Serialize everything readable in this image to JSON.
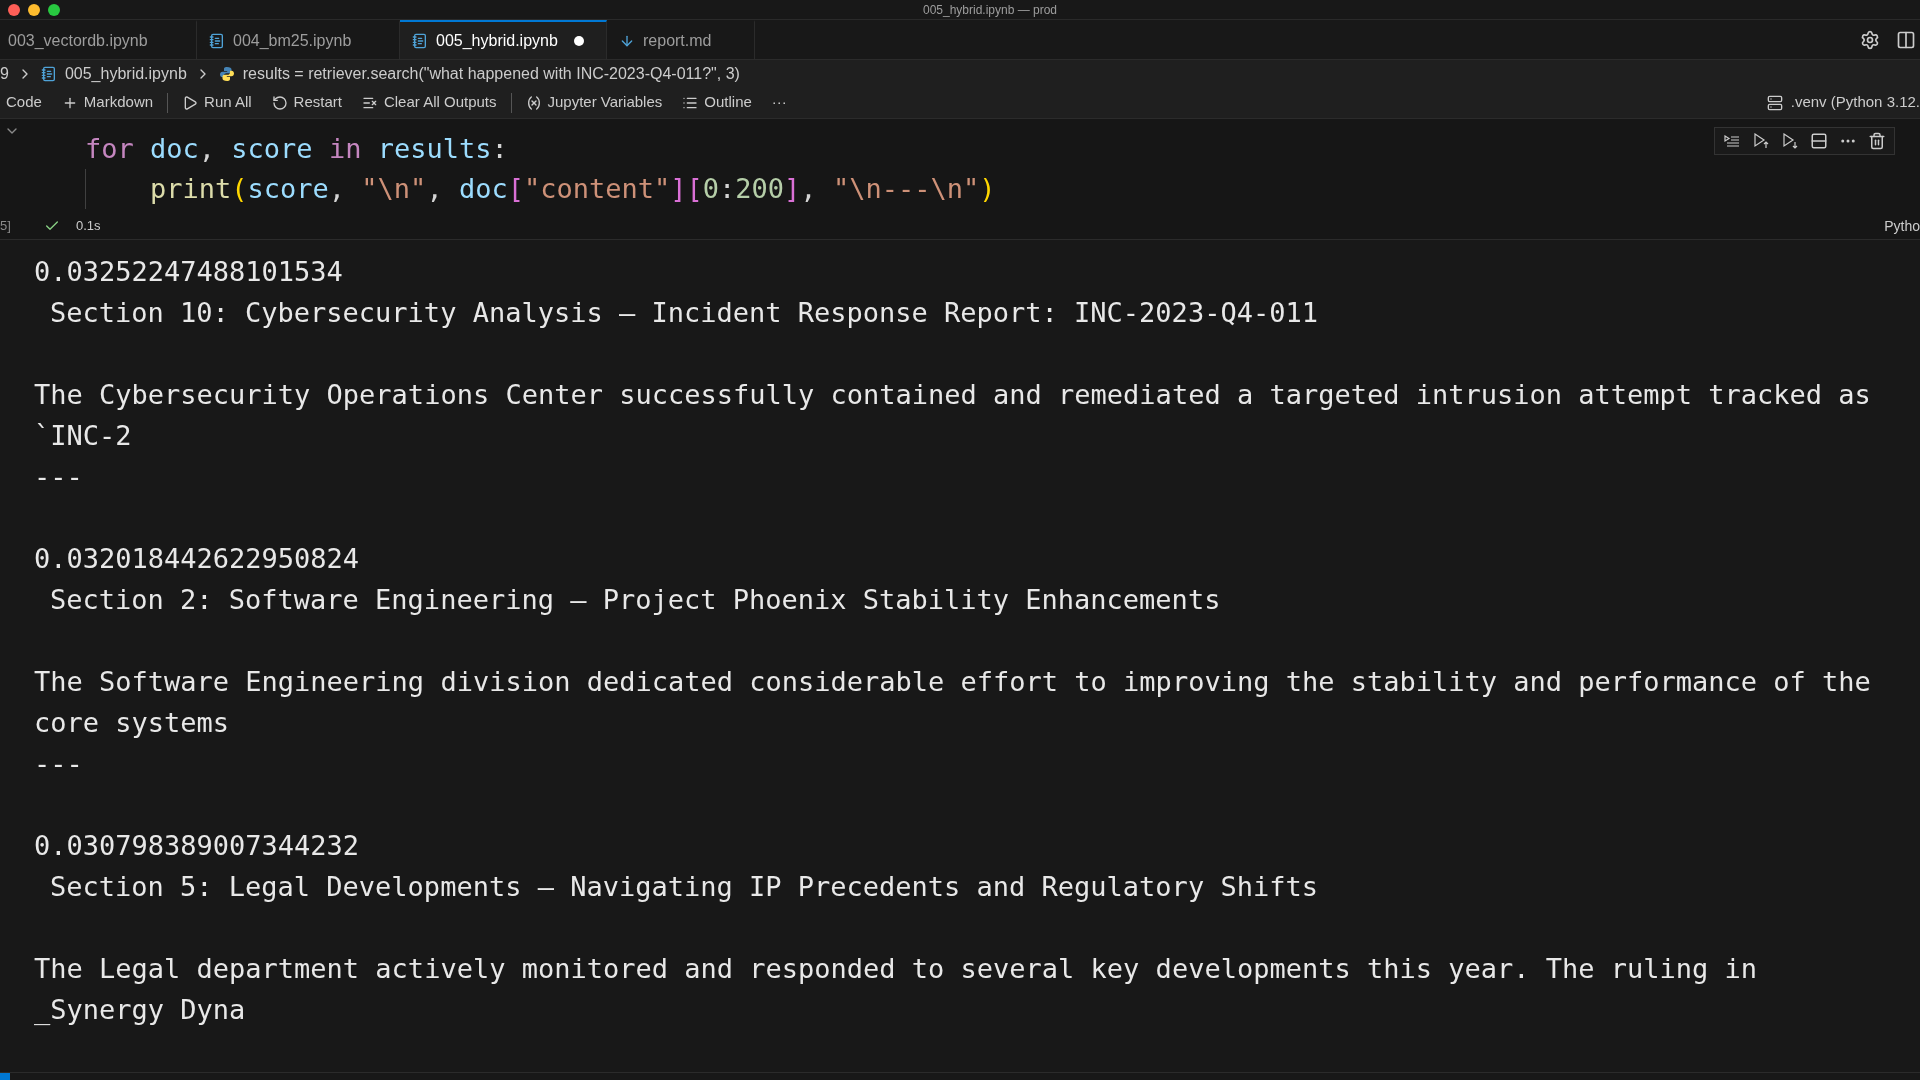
{
  "window": {
    "title": "005_hybrid.ipynb — prod"
  },
  "tabs": [
    {
      "label": "003_vectordb.ipynb",
      "kind": "plain",
      "selected": false,
      "modified": false
    },
    {
      "label": "004_bm25.ipynb",
      "kind": "notebook",
      "selected": false,
      "modified": false
    },
    {
      "label": "005_hybrid.ipynb",
      "kind": "notebook",
      "selected": true,
      "modified": true
    },
    {
      "label": "report.md",
      "kind": "markdown",
      "selected": false,
      "modified": false
    }
  ],
  "breadcrumb": {
    "prefix": "9",
    "file": "005_hybrid.ipynb",
    "symbol": "results = retriever.search(\"what happened with INC-2023-Q4-011?\", 3)"
  },
  "toolbar": {
    "items": [
      {
        "kind": "text",
        "label": "Code"
      },
      {
        "kind": "plus",
        "label": "Markdown"
      },
      {
        "kind": "separator"
      },
      {
        "kind": "run",
        "label": "Run All"
      },
      {
        "kind": "restart",
        "label": "Restart"
      },
      {
        "kind": "clear",
        "label": "Clear All Outputs"
      },
      {
        "kind": "separator"
      },
      {
        "kind": "variables",
        "label": "Jupyter Variables"
      },
      {
        "kind": "outline",
        "label": "Outline"
      },
      {
        "kind": "more",
        "label": "···"
      }
    ],
    "kernel": ".venv (Python 3.12."
  },
  "cell": {
    "execution_count": "5]",
    "duration": "0.1s",
    "language": "Pytho",
    "lines": [
      {
        "tokens": [
          {
            "kind": "keyword",
            "text": "for"
          },
          {
            "kind": "variable",
            "text": " doc"
          },
          {
            "kind": "punct",
            "text": ","
          },
          {
            "kind": "variable",
            "text": " score"
          },
          {
            "kind": "keyword",
            "text": " in"
          },
          {
            "kind": "variable",
            "text": " results"
          },
          {
            "kind": "punct",
            "text": ":"
          }
        ],
        "children": [
          {
            "tokens": [
              {
                "kind": "function",
                "text": "print"
              },
              {
                "kind": "bracket1",
                "text": "("
              },
              {
                "kind": "variable",
                "text": "score"
              },
              {
                "kind": "punct",
                "text": ", "
              },
              {
                "kind": "string",
                "text": "\"\\n\""
              },
              {
                "kind": "punct",
                "text": ", "
              },
              {
                "kind": "variable",
                "text": "doc"
              },
              {
                "kind": "bracket2",
                "text": "["
              },
              {
                "kind": "string",
                "text": "\"content\""
              },
              {
                "kind": "bracket2",
                "text": "]"
              },
              {
                "kind": "bracket2",
                "text": "["
              },
              {
                "kind": "number",
                "text": "0"
              },
              {
                "kind": "punct",
                "text": ":"
              },
              {
                "kind": "number",
                "text": "200"
              },
              {
                "kind": "bracket2",
                "text": "]"
              },
              {
                "kind": "punct",
                "text": ", "
              },
              {
                "kind": "string",
                "text": "\"\\n---\\n\""
              },
              {
                "kind": "bracket1",
                "text": ")"
              }
            ]
          }
        ]
      }
    ]
  },
  "output": [
    {
      "score": "0.03252247488101534",
      "heading": "Section 10: Cybersecurity Analysis – Incident Response Report: INC-2023-Q4-011",
      "body": [
        "The Cybersecurity Operations Center successfully contained and remediated a targeted intrusion attempt tracked as",
        "`INC-2"
      ],
      "separator": "---"
    },
    {
      "score": "0.032018442622950824",
      "heading": "Section 2: Software Engineering – Project Phoenix Stability Enhancements",
      "body": [
        "The Software Engineering division dedicated considerable effort to improving the stability and performance of the",
        "core systems"
      ],
      "separator": "---"
    },
    {
      "score": "0.030798389007344232",
      "heading": "Section 5: Legal Developments – Navigating IP Precedents and Regulatory Shifts",
      "body": [
        "The Legal department actively monitored and responded to several key developments this year. The ruling in",
        "_Synergy Dyna"
      ]
    }
  ]
}
